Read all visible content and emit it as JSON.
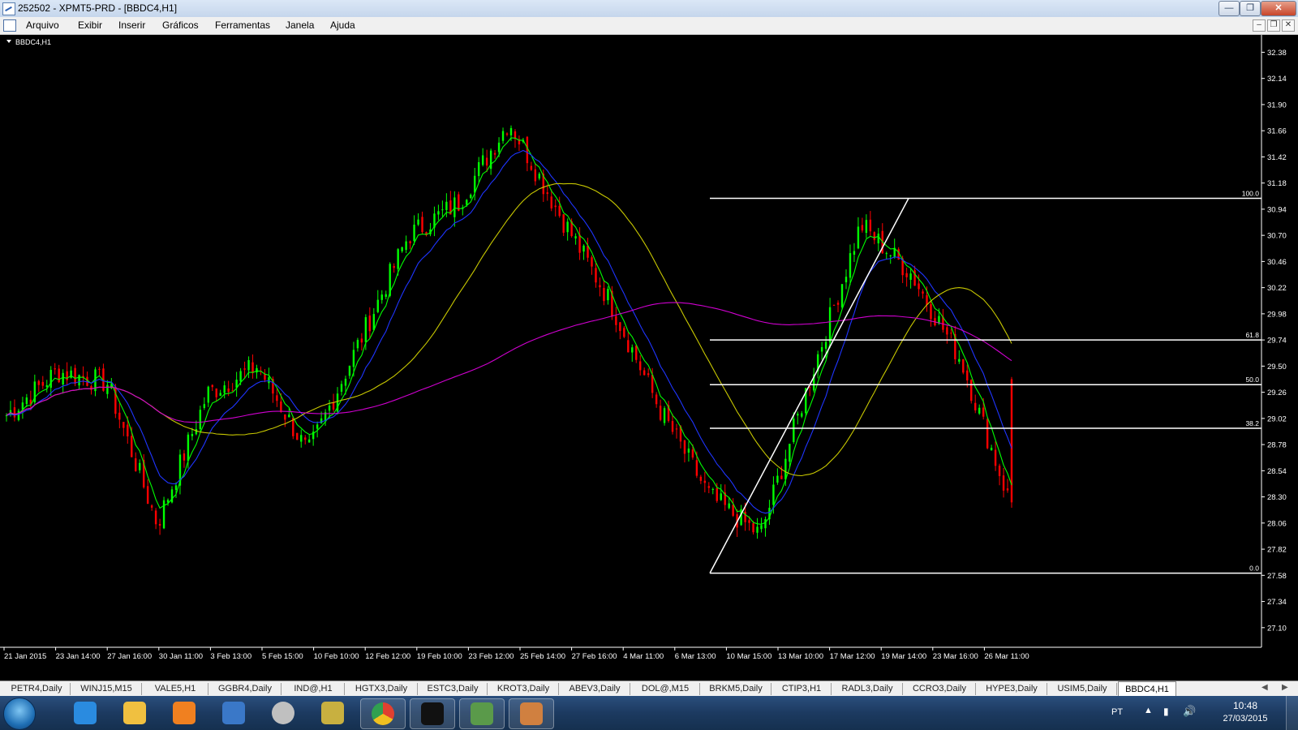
{
  "window": {
    "title": "252502 - XPMT5-PRD - [BBDC4,H1]",
    "min_label": "—",
    "max_label": "❐",
    "close_label": "✕"
  },
  "menu": [
    "Arquivo",
    "Exibir",
    "Inserir",
    "Gráficos",
    "Ferramentas",
    "Janela",
    "Ajuda"
  ],
  "mdi": {
    "min_label": "–",
    "restore_label": "❐",
    "close_label": "✕"
  },
  "chart": {
    "symbol_label": "BBDC4,H1",
    "price_ticks": [
      "32.38",
      "32.14",
      "31.90",
      "31.66",
      "31.42",
      "31.18",
      "30.94",
      "30.70",
      "30.46",
      "30.22",
      "29.98",
      "29.74",
      "29.50",
      "29.26",
      "29.02",
      "28.78",
      "28.54",
      "28.30",
      "28.06",
      "27.82",
      "27.58",
      "27.34",
      "27.10"
    ],
    "time_labels": [
      "21 Jan 2015",
      "23 Jan 14:00",
      "27 Jan 16:00",
      "30 Jan 11:00",
      "3 Feb 13:00",
      "5 Feb 15:00",
      "10 Feb 10:00",
      "12 Feb 12:00",
      "19 Feb 10:00",
      "23 Feb 12:00",
      "25 Feb 14:00",
      "27 Feb 16:00",
      "4 Mar 11:00",
      "6 Mar 13:00",
      "10 Mar 15:00",
      "13 Mar 10:00",
      "17 Mar 12:00",
      "19 Mar 14:00",
      "23 Mar 16:00",
      "26 Mar 11:00"
    ],
    "fib_levels": [
      {
        "label": "100.0",
        "price": 31.04
      },
      {
        "label": "61.8",
        "price": 29.74
      },
      {
        "label": "50.0",
        "price": 29.33
      },
      {
        "label": "38.2",
        "price": 28.93
      },
      {
        "label": "0.0",
        "price": 27.6
      }
    ],
    "colors": {
      "up": "#00ff00",
      "down": "#ff0000",
      "ma_fast": "#00ff00",
      "ma_blue": "#1f35ff",
      "ma_yellow": "#c8c800",
      "ma_magenta": "#d000d0",
      "fib": "#ffffff"
    }
  },
  "chart_data": {
    "type": "candlestick",
    "symbol": "BBDC4",
    "timeframe": "H1",
    "ylim": [
      26.92,
      32.48
    ],
    "x": [
      "21 Jan 2015",
      "23 Jan 14:00",
      "27 Jan 16:00",
      "30 Jan 11:00",
      "3 Feb 13:00",
      "5 Feb 15:00",
      "10 Feb 10:00",
      "12 Feb 12:00",
      "19 Feb 10:00",
      "23 Feb 12:00",
      "25 Feb 14:00",
      "27 Feb 16:00",
      "4 Mar 11:00",
      "6 Mar 13:00",
      "10 Mar 15:00",
      "13 Mar 10:00",
      "17 Mar 12:00",
      "19 Mar 14:00",
      "23 Mar 16:00",
      "26 Mar 11:00"
    ],
    "close_approx": [
      29.05,
      29.45,
      29.35,
      28.05,
      29.25,
      29.5,
      28.7,
      29.7,
      30.7,
      31.0,
      31.75,
      30.9,
      30.1,
      29.1,
      28.3,
      27.95,
      29.4,
      30.8,
      30.35,
      29.55
    ],
    "last_close": 28.2,
    "series": [
      {
        "name": "MA fast",
        "color": "#00ff00"
      },
      {
        "name": "MA blue",
        "color": "#1f35ff"
      },
      {
        "name": "MA yellow",
        "color": "#c8c800"
      },
      {
        "name": "MA magenta",
        "color": "#d000d0"
      }
    ],
    "fibonacci": {
      "high": 31.04,
      "low": 27.6,
      "levels": [
        "100.0",
        "61.8",
        "50.0",
        "38.2",
        "0.0"
      ]
    }
  },
  "tabs": [
    "PETR4,Daily",
    "WINJ15,M15",
    "VALE5,H1",
    "GGBR4,Daily",
    "IND@,H1",
    "HGTX3,Daily",
    "ESTC3,Daily",
    "KROT3,Daily",
    "ABEV3,Daily",
    "DOL@,M15",
    "BRKM5,Daily",
    "CTIP3,H1",
    "RADL3,Daily",
    "CCRO3,Daily",
    "HYPE3,Daily",
    "USIM5,Daily",
    "BBDC4,H1"
  ],
  "active_tab": "BBDC4,H1",
  "taskbar": {
    "apps": [
      {
        "name": "internet-explorer-icon",
        "color": "#2a8be0"
      },
      {
        "name": "folder-icon",
        "color": "#f0c040"
      },
      {
        "name": "media-player-icon",
        "color": "#f08020"
      },
      {
        "name": "remote-desktop-icon",
        "color": "#3a78c8"
      },
      {
        "name": "hp-icon",
        "color": "#c0c0c0"
      },
      {
        "name": "package-icon",
        "color": "#c8b040"
      },
      {
        "name": "chrome-icon",
        "color": "#e04030"
      },
      {
        "name": "xp-icon",
        "color": "#111111"
      },
      {
        "name": "metatrader-icon",
        "color": "#5a9a4a"
      },
      {
        "name": "paint-icon",
        "color": "#d08040"
      }
    ],
    "lang": "PT",
    "time": "10:48",
    "date": "27/03/2015"
  }
}
